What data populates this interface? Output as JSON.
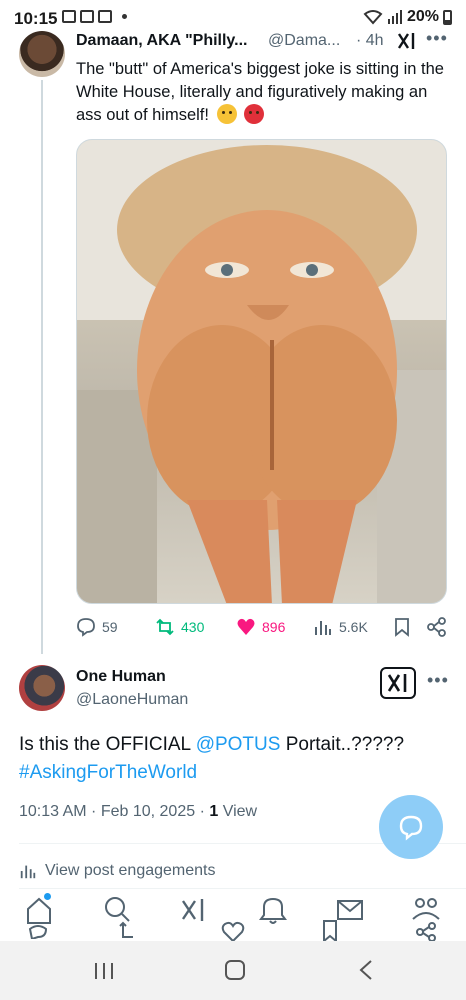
{
  "status_bar": {
    "time": "10:15",
    "battery": "20%"
  },
  "tweet1": {
    "author_name": "Damaan, AKA \"Philly...",
    "handle": "@Dama...",
    "time": "· 4h",
    "text": "The \"butt\" of America's biggest joke is sitting in the White House, literally and figuratively making an ass out of himself!",
    "emojis": [
      "angry-face",
      "pouting-face"
    ],
    "image_alt": "edited-photo",
    "stats": {
      "replies": "59",
      "reposts": "430",
      "likes": "896",
      "views": "5.6K"
    }
  },
  "tweet2": {
    "author_name": "One Human",
    "handle": "@LaoneHuman",
    "text_before": "Is this the OFFICIAL ",
    "mention": "@POTUS",
    "text_after": " Portait..?????",
    "hashtag": "#AskingForTheWorld",
    "timestamp": "10:13 AM · Feb 10, 2025 · ",
    "view_count": "1",
    "view_label": " View",
    "engagements_label": "View post engagements"
  },
  "colors": {
    "accent": "#1d9bf0",
    "repost": "#00ba7c",
    "like": "#f91880",
    "fab": "#8ecdf7"
  },
  "icons": [
    "reply-icon",
    "repost-icon",
    "like-icon",
    "views-icon",
    "bookmark-icon",
    "share-icon",
    "grok-icon",
    "more-icon",
    "home-icon",
    "search-icon",
    "notifications-icon",
    "messages-icon",
    "communities-icon",
    "compose-icon"
  ]
}
